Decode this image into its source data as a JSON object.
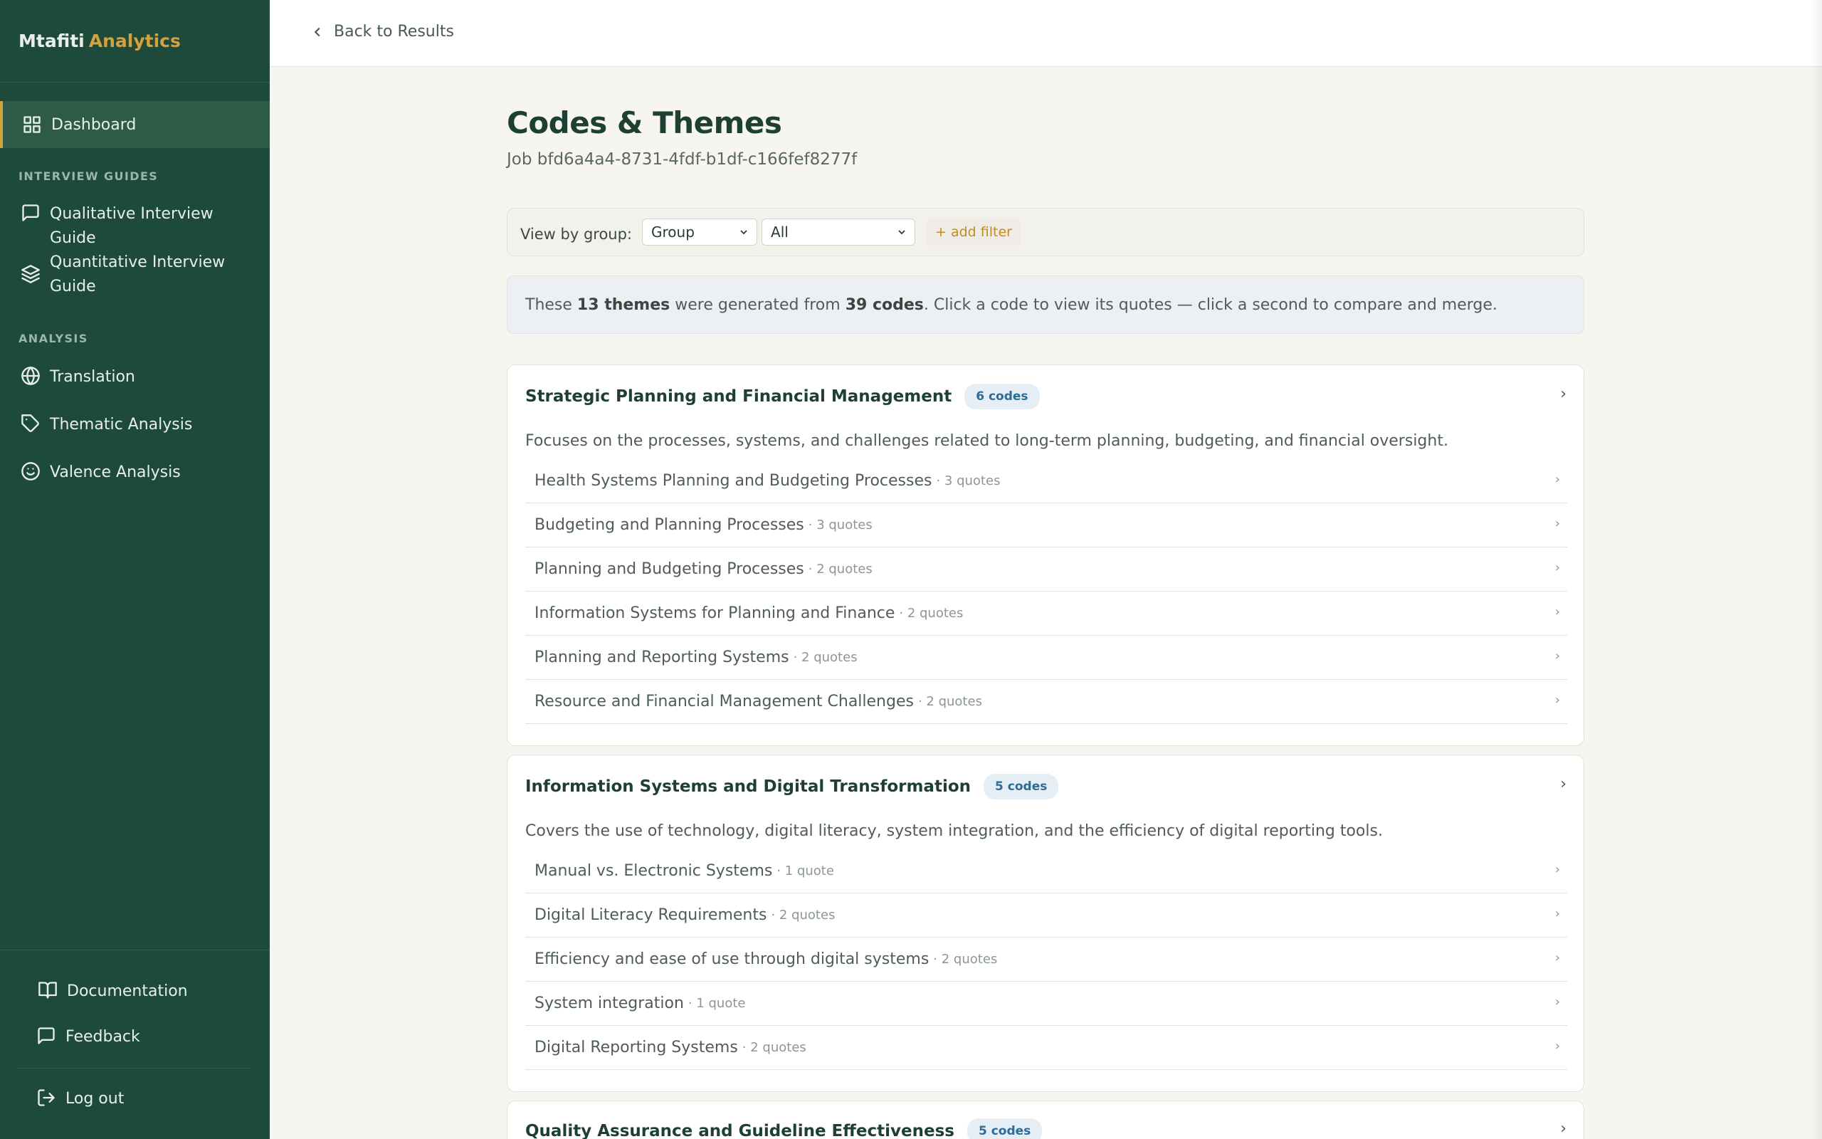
{
  "brand": {
    "name": "Mtafiti",
    "accent": "Analytics"
  },
  "sidebar": {
    "dashboard": "Dashboard",
    "section_guides": "INTERVIEW GUIDES",
    "qualitative": "Qualitative Interview Guide",
    "quantitative_line1": "Quantitative Interview",
    "quantitative_line2": "Guide",
    "section_analysis": "ANALYSIS",
    "translation": "Translation",
    "thematic": "Thematic Analysis",
    "valence": "Valence Analysis",
    "documentation": "Documentation",
    "feedback": "Feedback",
    "logout": "Log out"
  },
  "topbar": {
    "back": "Back to Results"
  },
  "page": {
    "title": "Codes & Themes",
    "job": "Job bfd6a4a4-8731-4fdf-b1df-c166fef8277f"
  },
  "filters": {
    "label": "View by group:",
    "group_value": "Group",
    "all_value": "All",
    "add_filter": "+ add filter"
  },
  "info": {
    "pre": "These ",
    "themes": "13 themes",
    "mid": " were generated from ",
    "codes": "39 codes",
    "post": ". Click a code to view its quotes — click a second to compare and merge."
  },
  "themes": [
    {
      "title": "Strategic Planning and Financial Management",
      "badge": "6 codes",
      "description": "Focuses on the processes, systems, and challenges related to long-term planning, budgeting, and financial oversight.",
      "codes": [
        {
          "name": "Health Systems Planning and Budgeting Processes",
          "count": "· 3 quotes"
        },
        {
          "name": "Budgeting and Planning Processes",
          "count": "· 3 quotes"
        },
        {
          "name": "Planning and Budgeting Processes",
          "count": "· 2 quotes"
        },
        {
          "name": "Information Systems for Planning and Finance",
          "count": "· 2 quotes"
        },
        {
          "name": "Planning and Reporting Systems",
          "count": "· 2 quotes"
        },
        {
          "name": "Resource and Financial Management Challenges",
          "count": "· 2 quotes"
        }
      ]
    },
    {
      "title": "Information Systems and Digital Transformation",
      "badge": "5 codes",
      "description": "Covers the use of technology, digital literacy, system integration, and the efficiency of digital reporting tools.",
      "codes": [
        {
          "name": "Manual vs. Electronic Systems",
          "count": "· 1 quote"
        },
        {
          "name": "Digital Literacy Requirements",
          "count": "· 2 quotes"
        },
        {
          "name": "Efficiency and ease of use through digital systems",
          "count": "· 2 quotes"
        },
        {
          "name": "System integration",
          "count": "· 1 quote"
        },
        {
          "name": "Digital Reporting Systems",
          "count": "· 2 quotes"
        }
      ]
    },
    {
      "title": "Quality Assurance and Guideline Effectiveness",
      "badge": "5 codes"
    }
  ],
  "chevron": "›"
}
